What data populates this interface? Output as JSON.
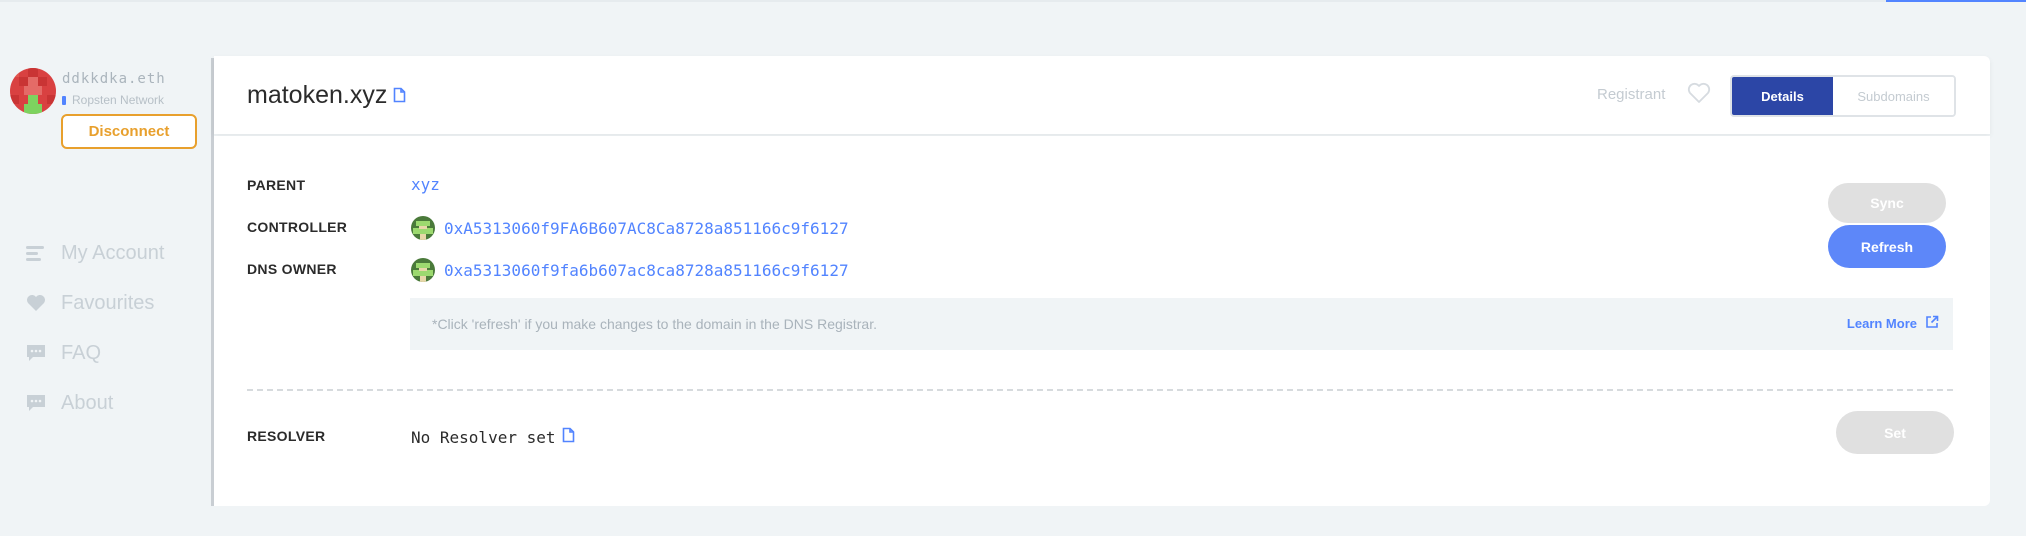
{
  "sidebar": {
    "account_name": "ddkkdka.eth",
    "network": "Ropsten Network",
    "disconnect_label": "Disconnect",
    "nav": [
      {
        "label": "My Account",
        "icon": "list-icon"
      },
      {
        "label": "Favourites",
        "icon": "heart-icon"
      },
      {
        "label": "FAQ",
        "icon": "chat-icon"
      },
      {
        "label": "About",
        "icon": "chat-icon"
      }
    ]
  },
  "header": {
    "domain": "matoken.xyz",
    "registrant_label": "Registrant",
    "tabs": [
      {
        "label": "Details",
        "active": true
      },
      {
        "label": "Subdomains",
        "active": false
      }
    ]
  },
  "details": {
    "parent_label": "PARENT",
    "parent_value": "xyz",
    "controller_label": "CONTROLLER",
    "controller_value": "0xA5313060f9FA6B607AC8Ca8728a851166c9f6127",
    "dns_owner_label": "DNS OWNER",
    "dns_owner_value": "0xa5313060f9fa6b607ac8ca8728a851166c9f6127",
    "sync_label": "Sync",
    "refresh_label": "Refresh",
    "notice_text": "*Click 'refresh' if you make changes to the domain in the DNS Registrar.",
    "learn_more_label": "Learn More",
    "resolver_label": "RESOLVER",
    "resolver_value": "No Resolver set",
    "set_label": "Set"
  },
  "colors": {
    "accent": "#5284ff",
    "tab_active": "#2c46a6",
    "disconnect": "#e8a02d",
    "disabled_button": "#e0e0e0"
  }
}
